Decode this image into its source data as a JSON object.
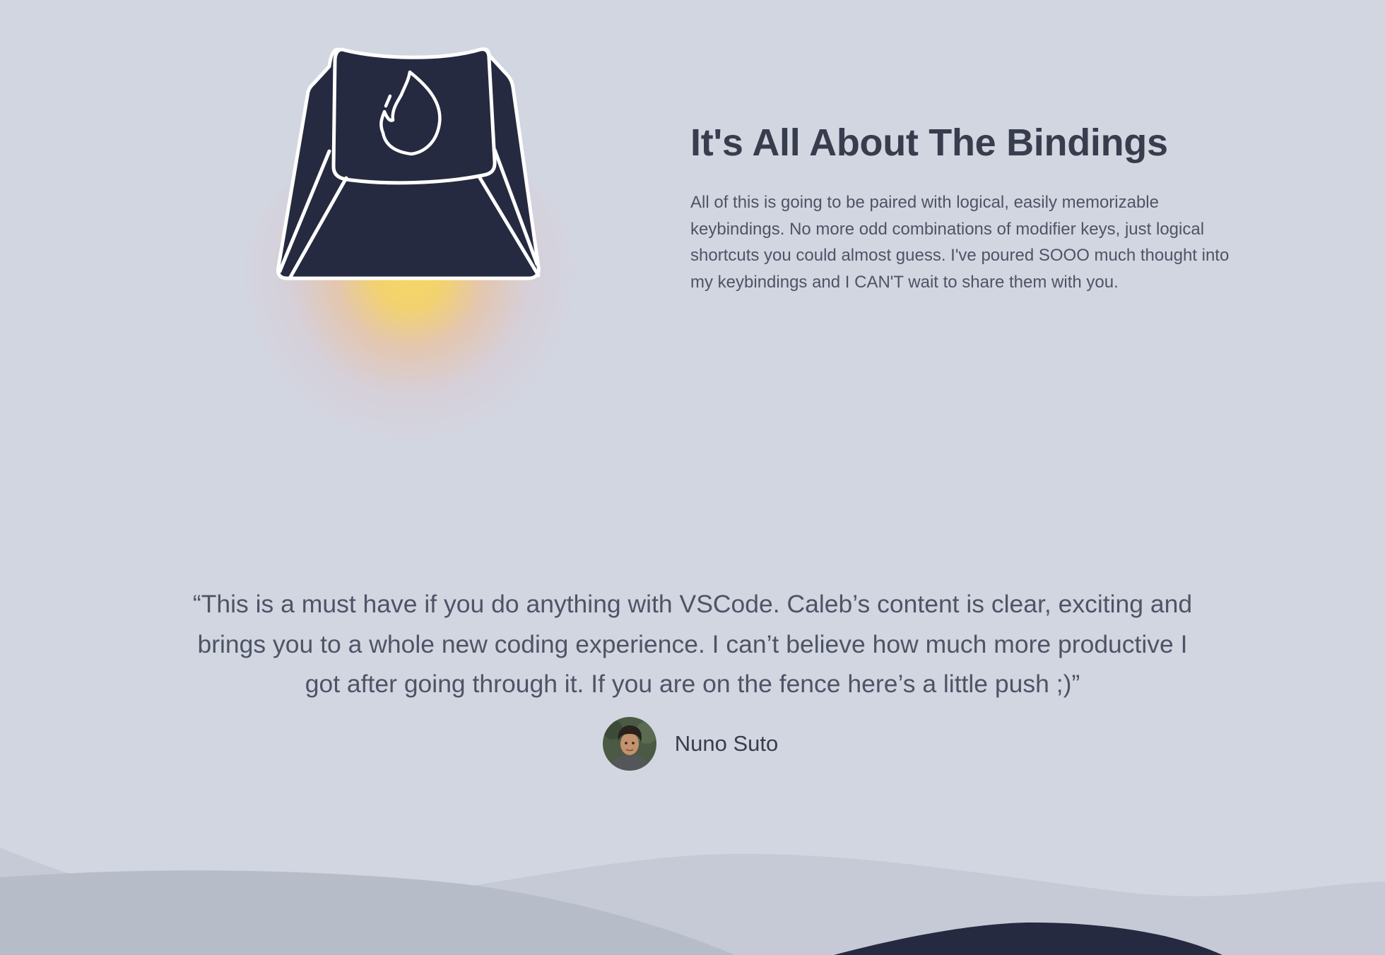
{
  "feature": {
    "title": "It's All About The Bindings",
    "body": "All of this is going to be paired with logical, easily memorizable keybindings. No more odd combinations of modifier keys, just logical shortcuts you could almost guess. I've poured SOOO much thought into my keybindings and I CAN'T wait to share them with you.",
    "icon": "fire-keycap-icon"
  },
  "testimonial": {
    "quote": "“This is a must have if you do anything with VSCode. Caleb’s content is clear, exciting and brings you to a whole new coding experience. I can’t believe how much more productive I got after going through it. If you are on the fence here’s a little push ;)”",
    "author": "Nuno Suto"
  },
  "colors": {
    "background": "#d2d6e1",
    "keycap": "#262a40",
    "heading": "#383d4e",
    "body_text": "#4e5466",
    "glow": "#f5d566"
  }
}
